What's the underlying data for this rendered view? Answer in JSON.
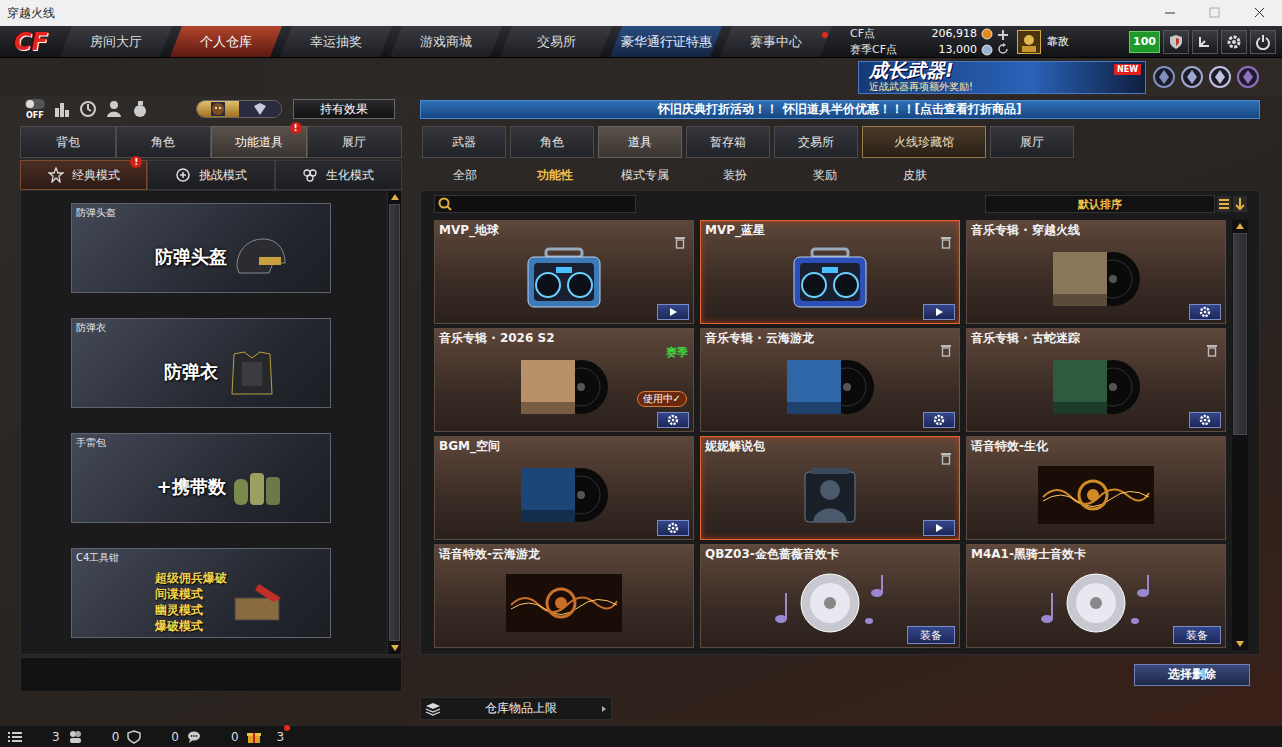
{
  "window": {
    "title": "穿越火线"
  },
  "nav": {
    "logo": "CF",
    "tabs": [
      {
        "label": "房间大厅",
        "selected": false,
        "kind": "normal",
        "dot": false
      },
      {
        "label": "个人仓库",
        "selected": true,
        "kind": "normal",
        "dot": false
      },
      {
        "label": "幸运抽奖",
        "selected": false,
        "kind": "normal",
        "dot": false
      },
      {
        "label": "游戏商城",
        "selected": false,
        "kind": "normal",
        "dot": false
      },
      {
        "label": "交易所",
        "selected": false,
        "kind": "normal",
        "dot": false
      },
      {
        "label": "豪华通行证特惠",
        "selected": false,
        "kind": "promo",
        "dot": false
      },
      {
        "label": "赛事中心",
        "selected": false,
        "kind": "normal",
        "dot": true
      }
    ]
  },
  "currency": [
    {
      "label": "CF点",
      "value": "206,918"
    },
    {
      "label": "赛季CF点",
      "value": "13,000"
    }
  ],
  "player": {
    "name": "靠敌",
    "level": "100"
  },
  "banner": {
    "title": "成长武器!",
    "subtitle": "近战武器再项额外奖励!",
    "badge": "NEW"
  },
  "left": {
    "off_label": "OFF",
    "view_toggle": [
      {
        "selected": true
      },
      {
        "selected": false
      }
    ],
    "effect_button": "持有效果",
    "tabs": [
      {
        "label": "背包",
        "selected": false,
        "badge": null
      },
      {
        "label": "角色",
        "selected": false,
        "badge": null
      },
      {
        "label": "功能道具",
        "selected": true,
        "badge": "!"
      },
      {
        "label": "展厅",
        "selected": false,
        "badge": null
      }
    ],
    "modes": [
      {
        "label": "经典模式",
        "selected": true,
        "badge": "!"
      },
      {
        "label": "挑战模式",
        "selected": false,
        "badge": null
      },
      {
        "label": "生化模式",
        "selected": false,
        "badge": null
      }
    ],
    "items": [
      {
        "label": "防弹头盔",
        "kind": "big",
        "caption": [
          "防弹头盔"
        ]
      },
      {
        "label": "防弹衣",
        "kind": "big",
        "caption": [
          "防弹衣"
        ]
      },
      {
        "label": "手雷包",
        "kind": "big",
        "caption": [
          "+携带数"
        ]
      },
      {
        "label": "C4工具钳",
        "kind": "list",
        "caption": [
          "超级佣兵爆破",
          "间谍模式",
          "幽灵模式",
          "爆破模式"
        ]
      }
    ],
    "scrollbar": {
      "level": 1
    }
  },
  "right": {
    "notice": "怀旧庆典打折活动！！ 怀旧道具半价优惠！！！[点击查看打折商品]",
    "tabs": [
      {
        "label": "武器",
        "selected": false,
        "kind": "normal"
      },
      {
        "label": "角色",
        "selected": false,
        "kind": "normal"
      },
      {
        "label": "道具",
        "selected": true,
        "kind": "normal"
      },
      {
        "label": "暂存箱",
        "selected": false,
        "kind": "normal"
      },
      {
        "label": "交易所",
        "selected": false,
        "kind": "normal"
      },
      {
        "label": "火线珍藏馆",
        "selected": false,
        "kind": "special"
      },
      {
        "label": "展厅",
        "selected": false,
        "kind": "normal"
      }
    ],
    "subtabs": [
      {
        "label": "全部",
        "selected": false
      },
      {
        "label": "功能性",
        "selected": true
      },
      {
        "label": "模式专属",
        "selected": false
      },
      {
        "label": "装扮",
        "selected": false
      },
      {
        "label": "奖励",
        "selected": false
      },
      {
        "label": "皮肤",
        "selected": false
      }
    ],
    "search": {
      "placeholder": ""
    },
    "sort": "默认排序",
    "cards": [
      {
        "title": "MVP_地球",
        "selected": false,
        "kind": "speaker",
        "color": "#3d7ab8",
        "trash": true,
        "action": {
          "kind": "play",
          "label": null
        },
        "season": null,
        "in_use": null
      },
      {
        "title": "MVP_蓝星",
        "selected": true,
        "kind": "speaker",
        "color": "#2c4fb8",
        "trash": true,
        "action": {
          "kind": "play",
          "label": null
        },
        "season": null,
        "in_use": null
      },
      {
        "title": "音乐专辑 · 穿越火线",
        "selected": false,
        "kind": "album",
        "color": "#8a7658",
        "trash": false,
        "action": {
          "kind": "gear",
          "label": null
        },
        "season": null,
        "in_use": null
      },
      {
        "title": "音乐专辑 · 2026 S2",
        "selected": false,
        "kind": "album",
        "color": "#b8906a",
        "trash": false,
        "action": {
          "kind": "gear",
          "label": null
        },
        "season": "赛季",
        "in_use": "使用中✓"
      },
      {
        "title": "音乐专辑 · 云海游龙",
        "selected": false,
        "kind": "album",
        "color": "#2f66a8",
        "trash": true,
        "action": {
          "kind": "gear",
          "label": null
        },
        "season": null,
        "in_use": null
      },
      {
        "title": "音乐专辑 · 古蛇迷踪",
        "selected": false,
        "kind": "album",
        "color": "#2e5a40",
        "trash": true,
        "action": {
          "kind": "gear",
          "label": null
        },
        "season": null,
        "in_use": null
      },
      {
        "title": "BGM_空间",
        "selected": false,
        "kind": "album",
        "color": "#1c4678",
        "trash": false,
        "action": {
          "kind": "gear",
          "label": null
        },
        "season": null,
        "in_use": null
      },
      {
        "title": "妮妮解说包",
        "selected": true,
        "kind": "voice-pack",
        "color": "#4a5a6c",
        "trash": true,
        "action": {
          "kind": "play",
          "label": null
        },
        "season": null,
        "in_use": null
      },
      {
        "title": "语音特效-生化",
        "selected": false,
        "kind": "voice-effect",
        "color": "#d08a28",
        "trash": false,
        "action": {
          "kind": "none",
          "label": null
        },
        "season": null,
        "in_use": null
      },
      {
        "title": "语音特效-云海游龙",
        "selected": false,
        "kind": "voice-effect",
        "color": "#c8702a",
        "trash": false,
        "action": {
          "kind": "none",
          "label": null
        },
        "season": null,
        "in_use": null
      },
      {
        "title": "QBZ03-金色蔷薇音效卡",
        "selected": false,
        "kind": "sound-card",
        "color": "#9a88d0",
        "trash": false,
        "action": {
          "kind": "equip",
          "label": "装备"
        },
        "season": null,
        "in_use": null
      },
      {
        "title": "M4A1-黑骑士音效卡",
        "selected": false,
        "kind": "sound-card",
        "color": "#9a88d0",
        "trash": false,
        "action": {
          "kind": "equip",
          "label": "装备"
        },
        "season": null,
        "in_use": null
      }
    ],
    "scrollbar": {
      "level": 0.5
    },
    "delete_button": "选择删除",
    "capacity": "仓库物品上限"
  },
  "status_bar": {
    "items": [
      {
        "count": "3",
        "kind": "friends"
      },
      {
        "count": "0",
        "kind": "guild"
      },
      {
        "count": "0",
        "kind": "chat"
      },
      {
        "count": "0",
        "kind": "gift"
      }
    ],
    "mail": {
      "count": "3",
      "dot": true
    }
  }
}
